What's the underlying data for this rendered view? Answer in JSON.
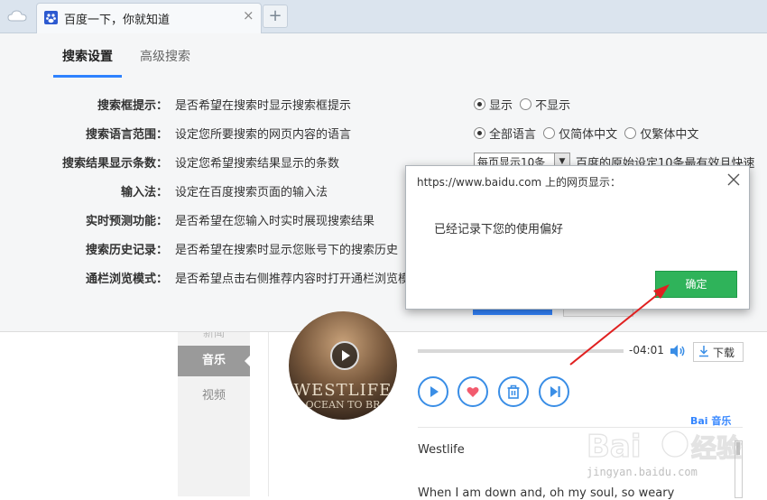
{
  "browser": {
    "tab_title": "百度一下，你就知道",
    "tab_close": "×",
    "new_tab": "+"
  },
  "settings": {
    "tabs": [
      {
        "label": "搜索设置",
        "active": true
      },
      {
        "label": "高级搜索",
        "active": false
      }
    ],
    "rows": [
      {
        "label": "搜索框提示：",
        "desc": "是否希望在搜索时显示搜索框提示"
      },
      {
        "label": "搜索语言范围：",
        "desc": "设定您所要搜索的网页内容的语言"
      },
      {
        "label": "搜索结果显示条数：",
        "desc": "设定您希望搜索结果显示的条数"
      },
      {
        "label": "输入法：",
        "desc": "设定在百度搜索页面的输入法"
      },
      {
        "label": "实时预测功能：",
        "desc": "是否希望在您输入时实时展现搜索结果"
      },
      {
        "label": "搜索历史记录：",
        "desc": "是否希望在搜索时显示您账号下的搜索历史"
      },
      {
        "label": "通栏浏览模式：",
        "desc": "是否希望点击右侧推荐内容时打开通栏浏览模"
      }
    ],
    "suggest_options": {
      "show": "显示",
      "hide": "不显示",
      "selected": "显示"
    },
    "language_options": {
      "all": "全部语言",
      "simplified": "仅简体中文",
      "traditional": "仅繁体中文",
      "selected": "全部语言"
    },
    "results_select": {
      "value": "每页显示10条",
      "note": "百度的原始设定10条最有效且快速"
    }
  },
  "sidebar": {
    "cut_item": "新闻",
    "music": "音乐",
    "video": "视频"
  },
  "player": {
    "album_text": "WESTLIFE",
    "album_sub": "OCEAN TO BR",
    "time": "-04:01",
    "download": "下载",
    "progress": 0,
    "brand": "Bai 音乐",
    "artist": "Westlife",
    "lyric": "When I am down and, oh my soul, so weary"
  },
  "dialog": {
    "title": "https://www.baidu.com 上的网页显示：",
    "message": "已经记录下您的使用偏好",
    "ok": "确定"
  },
  "watermark": {
    "domain": "jingyan.baidu.com"
  },
  "colors": {
    "accent": "#3385ff",
    "ok_green": "#2fb35a",
    "arrow_red": "#e02020",
    "control_blue": "#3a8ee6"
  }
}
